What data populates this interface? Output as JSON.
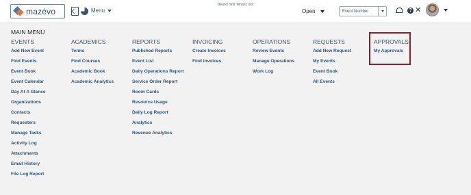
{
  "header": {
    "logo_text": "mazévo",
    "menu_label": "Menu",
    "tenant_text": "Dean's Test Tenant, xxx",
    "status_value": "Open",
    "search_value": "Event Number",
    "icons": [
      "document-icon",
      "pie-chart-icon",
      "bell-icon",
      "help-icon",
      "tools-icon",
      "avatar",
      "chevron-down-icon"
    ]
  },
  "main_menu": {
    "title": "MAIN MENU",
    "columns": [
      {
        "heading": "EVENTS",
        "items": [
          "Add New Event",
          "Find Events",
          "Event Book",
          "Event Calendar",
          "Day At A Glance",
          "Organizations",
          "Contacts",
          "Requesters",
          "Manage Tasks",
          "Activity Log",
          "Attachments",
          "Email History",
          "File Log Report"
        ]
      },
      {
        "heading": "ACADEMICS",
        "items": [
          "Terms",
          "Find Courses",
          "Academic Book",
          "Academic Analytics"
        ]
      },
      {
        "heading": "REPORTS",
        "items": [
          "Published Reports",
          "Event List",
          "Daily Operations Report",
          "Service Order Report",
          "Room Cards",
          "Resource Usage",
          "Daily Log Report",
          "Analytics",
          "Revenue Analytics"
        ]
      },
      {
        "heading": "INVOICING",
        "items": [
          "Create Invoices",
          "Find Invoices"
        ]
      },
      {
        "heading": "OPERATIONS",
        "items": [
          "Review Events",
          "Manage Operations",
          "Work Log"
        ]
      },
      {
        "heading": "REQUESTS",
        "items": [
          "Add New Request",
          "My Events",
          "Event Book",
          "All Events"
        ]
      },
      {
        "heading": "APPROVALS",
        "items": [
          "My Approvals"
        ]
      }
    ]
  },
  "colors": {
    "link": "#2d5478",
    "heading": "#3d5566",
    "highlight_border": "#8c1f2a",
    "background": "#f2f2f2"
  }
}
